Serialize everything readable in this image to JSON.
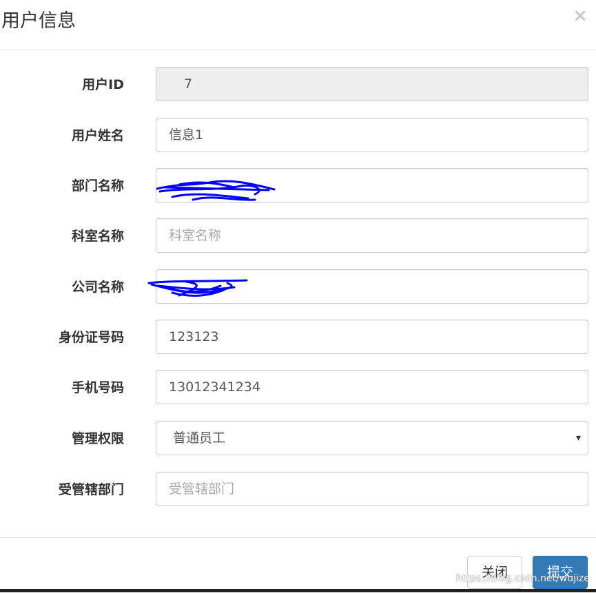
{
  "modal": {
    "title": "用户信息",
    "close_icon": "×"
  },
  "fields": [
    {
      "label": "用户ID",
      "value": "7"
    },
    {
      "label": "用户姓名",
      "value": "信息1"
    },
    {
      "label": "部门名称",
      "value": ""
    },
    {
      "label": "科室名称",
      "placeholder": "科室名称"
    },
    {
      "label": "公司名称",
      "value": ""
    },
    {
      "label": "身份证号码",
      "value": "123123"
    },
    {
      "label": "手机号码",
      "value": "13012341234"
    },
    {
      "label": "管理权限",
      "value": "普通员工"
    },
    {
      "label": "受管辖部门",
      "placeholder": "受管辖部门"
    }
  ],
  "select_caret": "▾",
  "footer": {
    "close_label": "关闭",
    "submit_label": "提交"
  },
  "watermark": "https://blog.csdn.net/wujize",
  "colors": {
    "primary": "#337ab7",
    "readonly_bg": "#eeeeee",
    "border": "#cccccc",
    "scribble": "#0000ff"
  }
}
